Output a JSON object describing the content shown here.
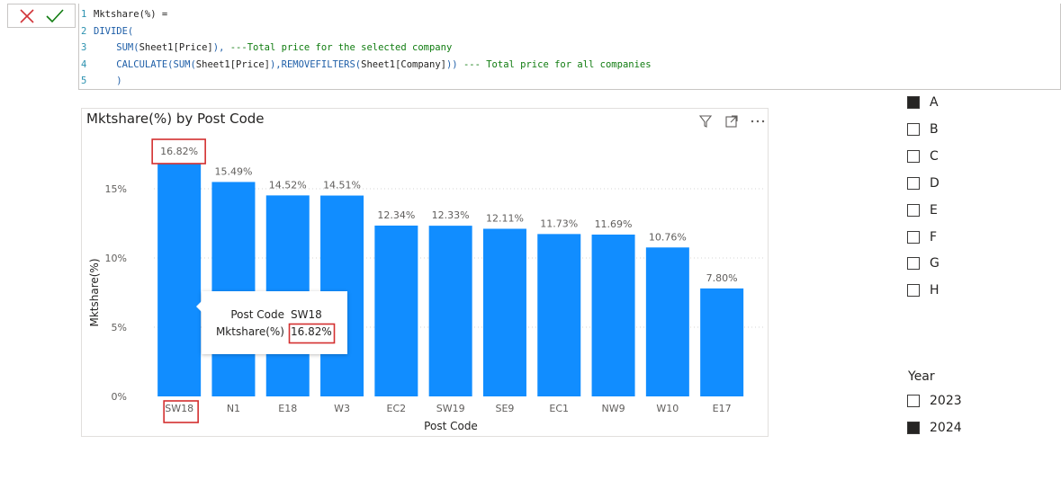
{
  "formula_bar": {
    "cancel_icon": "x-icon",
    "commit_icon": "check-icon",
    "lines": [
      {
        "num": "1",
        "parts": [
          {
            "t": "Mktshare(%) =",
            "c": "tk"
          }
        ]
      },
      {
        "num": "2",
        "parts": [
          {
            "t": "DIVIDE(",
            "c": "kw"
          }
        ]
      },
      {
        "num": "3",
        "parts": [
          {
            "t": "    SUM(",
            "c": "kw"
          },
          {
            "t": "Sheet1[Price]",
            "c": "tk"
          },
          {
            "t": "), ",
            "c": "kw"
          },
          {
            "t": "---Total price for the selected company",
            "c": "cm"
          }
        ]
      },
      {
        "num": "4",
        "parts": [
          {
            "t": "    CALCULATE(SUM(",
            "c": "kw"
          },
          {
            "t": "Sheet1[Price]",
            "c": "tk"
          },
          {
            "t": "),REMOVEFILTERS(",
            "c": "kw"
          },
          {
            "t": "Sheet1[Company]",
            "c": "tk"
          },
          {
            "t": ")) ",
            "c": "kw"
          },
          {
            "t": "--- Total price for all companies",
            "c": "cm"
          }
        ]
      },
      {
        "num": "5",
        "parts": [
          {
            "t": "    )",
            "c": "kw"
          }
        ]
      }
    ]
  },
  "visual": {
    "title": "Mktshare(%) by Post Code",
    "header_icons": [
      "filter-icon",
      "focus-mode-icon",
      "more-options-icon"
    ]
  },
  "chart_data": {
    "type": "bar",
    "title": "Mktshare(%) by Post Code",
    "xlabel": "Post Code",
    "ylabel": "Mktshare(%)",
    "categories": [
      "SW18",
      "N1",
      "E18",
      "W3",
      "EC2",
      "SW19",
      "SE9",
      "EC1",
      "NW9",
      "W10",
      "E17"
    ],
    "values": [
      16.82,
      15.49,
      14.52,
      14.51,
      12.34,
      12.33,
      12.11,
      11.73,
      11.69,
      10.76,
      7.8
    ],
    "data_labels": [
      "16.82%",
      "15.49%",
      "14.52%",
      "14.51%",
      "12.34%",
      "12.33%",
      "12.11%",
      "11.73%",
      "11.69%",
      "10.76%",
      "7.80%"
    ],
    "yticks": [
      0,
      5,
      10,
      15
    ],
    "ytick_labels": [
      "0%",
      "5%",
      "10%",
      "15%"
    ],
    "ylim": [
      0,
      17
    ],
    "grid": true,
    "bar_color": "#118dff",
    "highlight_color": "#d32f2f",
    "highlighted_category": "SW18"
  },
  "tooltip": {
    "rows": [
      {
        "label": "Post Code",
        "value": "SW18"
      },
      {
        "label": "Mktshare(%)",
        "value": "16.82%"
      }
    ]
  },
  "company_slicer": {
    "items": [
      {
        "label": "A",
        "checked": true
      },
      {
        "label": "B",
        "checked": false
      },
      {
        "label": "C",
        "checked": false
      },
      {
        "label": "D",
        "checked": false
      },
      {
        "label": "E",
        "checked": false
      },
      {
        "label": "F",
        "checked": false
      },
      {
        "label": "G",
        "checked": false
      },
      {
        "label": "H",
        "checked": false
      }
    ]
  },
  "year_slicer": {
    "title": "Year",
    "items": [
      {
        "label": "2023",
        "checked": false
      },
      {
        "label": "2024",
        "checked": true
      }
    ]
  }
}
